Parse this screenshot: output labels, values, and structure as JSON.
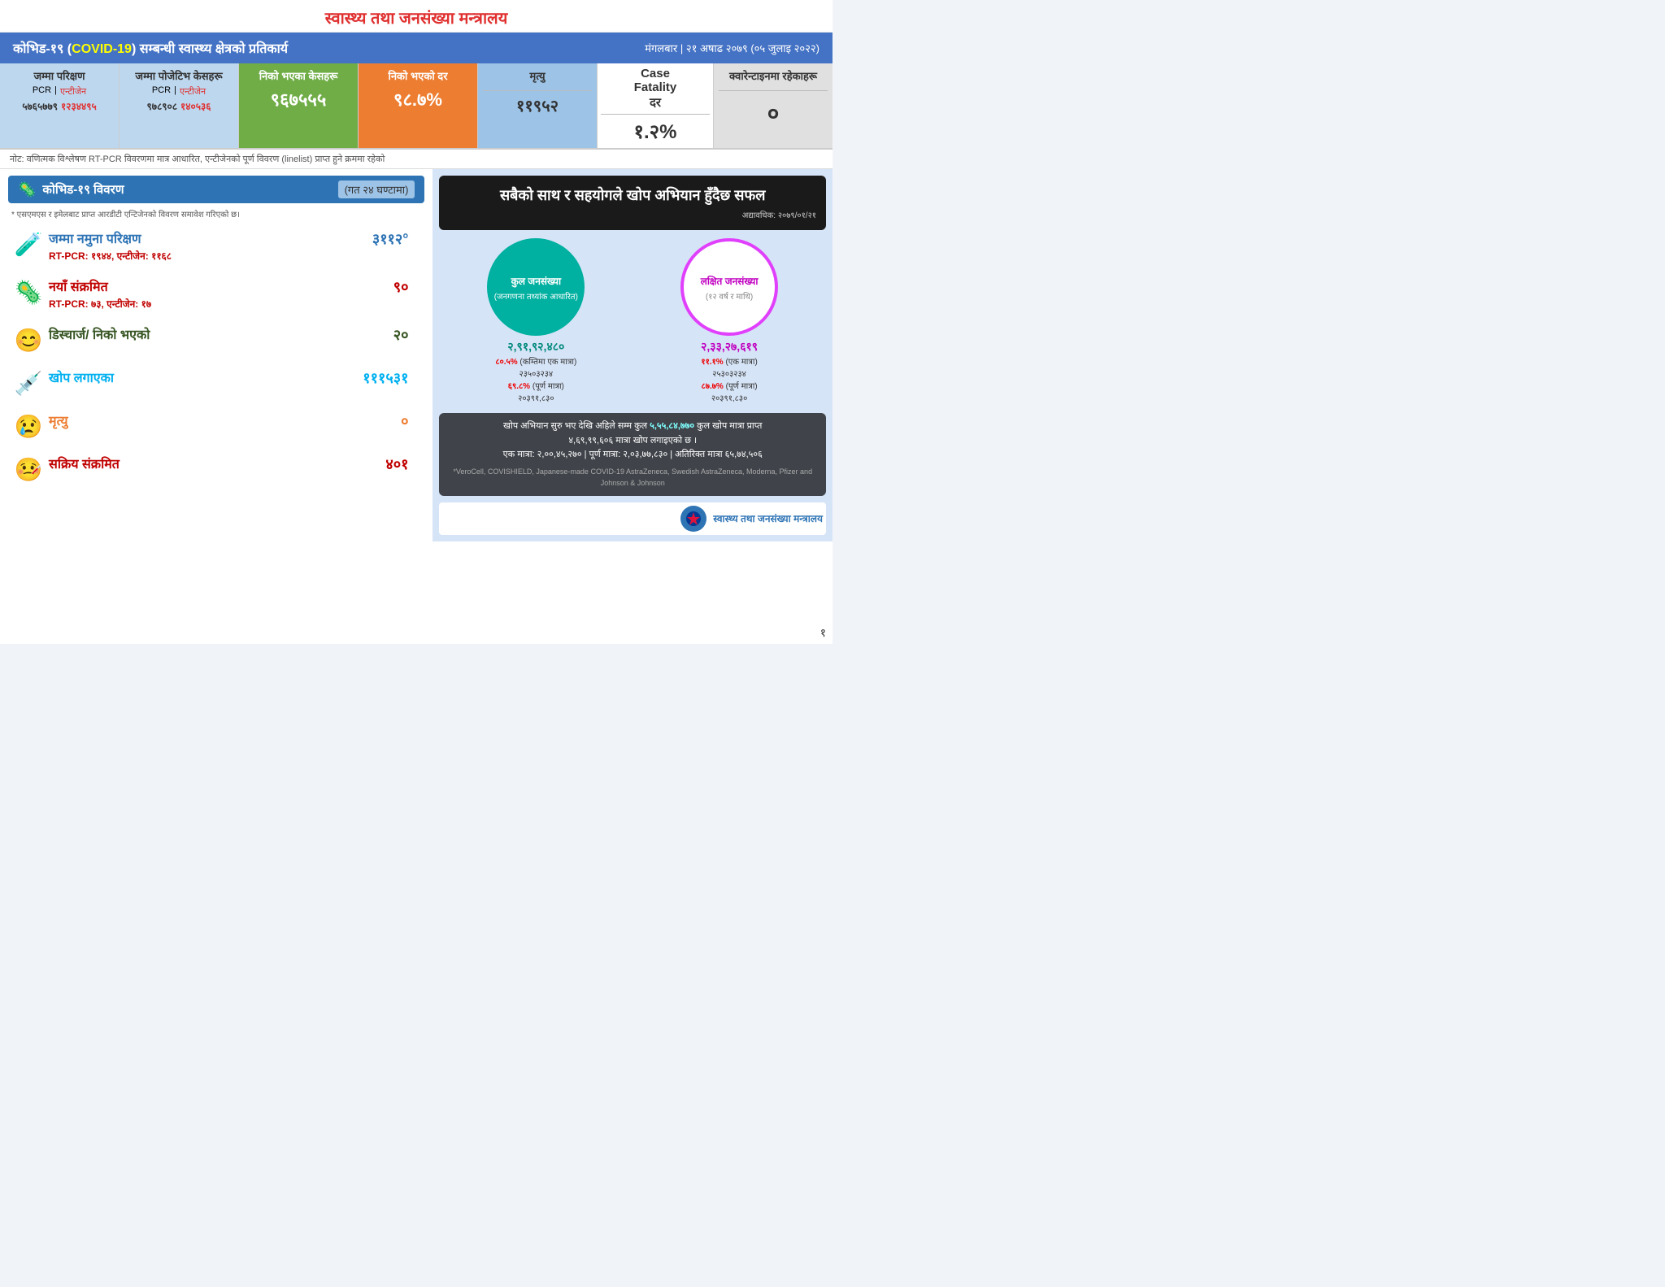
{
  "header": {
    "top_title": "स्वास्थ्य तथा जनसंख्या मन्त्रालय",
    "main_title_nepali": "कोभिड-१९ (COVID-19) सम्बन्धी स्वास्थ्य क्षेत्रको प्रतिकार्य",
    "covid_text": "COVID-19",
    "date": "मंगलबार | २१ अषाढ २०७९ (०५ जुलाइ २०२२)"
  },
  "stats": {
    "total_test_label": "जम्मा परिक्षण",
    "total_positive_label": "जम्मा पोजेटिभ केसहरू",
    "recovered_label": "निको भएका केसहरू",
    "recovery_rate_label": "निको भएको दर",
    "death_label": "मृत्यु",
    "case_fatality_label1": "Case",
    "case_fatality_label2": "Fatality",
    "case_fatality_label3": "दर",
    "quarantine_label": "क्वारेन्टाइनमा रहेकाहरू",
    "pcr_label": "PCR",
    "antigen_label": "एन्टीजेन",
    "total_pcr_val": "५७६५७७९",
    "total_antigen_val": "१२३४४९५",
    "positive_pcr_val": "९७८९०८",
    "positive_antigen_val": "१४०५३६",
    "recovered_val": "९६७५५५",
    "recovery_rate_val": "९८.७%",
    "death_val": "११९५२",
    "case_fatality_val": "१.२%",
    "quarantine_val": "०"
  },
  "note": "नोट: वणित्मक विश्लेषण RT-PCR विवरणमा मात्र आधारित, एन्टीजेनको पूर्ण विवरण (linelist) प्राप्त हुने क्रममा रहेको",
  "left_section": {
    "title": "कोभिड-१९ विवरण",
    "subtitle": "(गत २४ घण्टामा)",
    "subnote": "* एसएमएस र इमेलबाट प्राप्त आरडीटी एन्टिजेनको विवरण समावेश गरिएको छ।",
    "items": [
      {
        "icon": "🧪",
        "label": "जम्मा नमुना परिक्षण",
        "value": "३११२°",
        "sub": "RT-PCR: १९४४, एन्टीजेन: ११६८",
        "color": "blue"
      },
      {
        "icon": "🦠",
        "label": "नयाँ संक्रमित",
        "value": "९०",
        "sub": "RT-PCR: ७३,  एन्टीजेन: १७",
        "color": "red"
      },
      {
        "icon": "😊",
        "label": "डिस्चार्ज/ निको भएको",
        "value": "२०",
        "sub": "",
        "color": "green"
      },
      {
        "icon": "💉",
        "label": "खोप लगाएका",
        "value": "१११५३१",
        "sub": "",
        "color": "teal"
      },
      {
        "icon": "😢",
        "label": "मृत्यु",
        "value": "०",
        "sub": "",
        "color": "orange"
      },
      {
        "icon": "🤒",
        "label": "सक्रिय संक्रमित",
        "value": "४०१",
        "sub": "",
        "color": "red"
      }
    ]
  },
  "right_section": {
    "banner_title": "सबैको साथ र सहयोगले खोप अभियान हुँदैछ सफल",
    "date_label": "अद्यावधिक: २०७९/०१/२१",
    "circle1": {
      "label": "कुल जनसंख्या",
      "sublabel": "(जनगणना तथ्यांक आधारित)",
      "value": "२,९१,९२,४८०",
      "stats1_pct": "८०.५%",
      "stats1_label": "(कम्तिमा एक मात्रा)",
      "stats1_val": "२३५०३२३४",
      "stats2_pct": "६९.८%",
      "stats2_label": "(पूर्ण मात्रा)",
      "stats2_val": "२०३९१,८३०",
      "color": "teal"
    },
    "circle2": {
      "label": "लक्षित जनसंख्या",
      "sublabel": "(१२ वर्ष र माथि)",
      "value": "२,३३,२७,६१९",
      "stats1_pct": "११.१%",
      "stats1_label": "(एक मात्रा)",
      "stats1_val": "२५३०३२३४",
      "stats2_pct": "८७.७%",
      "stats2_label": "(पूर्ण मात्रा)",
      "stats2_val": "२०३९१,८३०",
      "color": "pink"
    },
    "bottom": {
      "text1": "खोप अभियान सुरु भए देखि अहिले सम्म कुल",
      "value1": "५,५५,८४,७७०",
      "label1": "कुल खोप मात्रा प्राप्त",
      "text2": "४,६९,९९,६०६ मात्रा खोप लगाइएको छ ।",
      "text3": "एक मात्रा: २,००,४५,२७० | पूर्ण मात्रा: २,०३,७७,८३० | अतिरिक्त मात्रा ६५,७४,५०६",
      "footnote": "*VeroCell, COVISHIELD, Japanese-made COVID-19 AstraZeneca, Swedish AstraZeneca, Moderna, Pfizer and Johnson & Johnson"
    },
    "ministry": "स्वास्थ्य तथा जनसंख्या मन्त्रालय"
  },
  "page_number": "१"
}
